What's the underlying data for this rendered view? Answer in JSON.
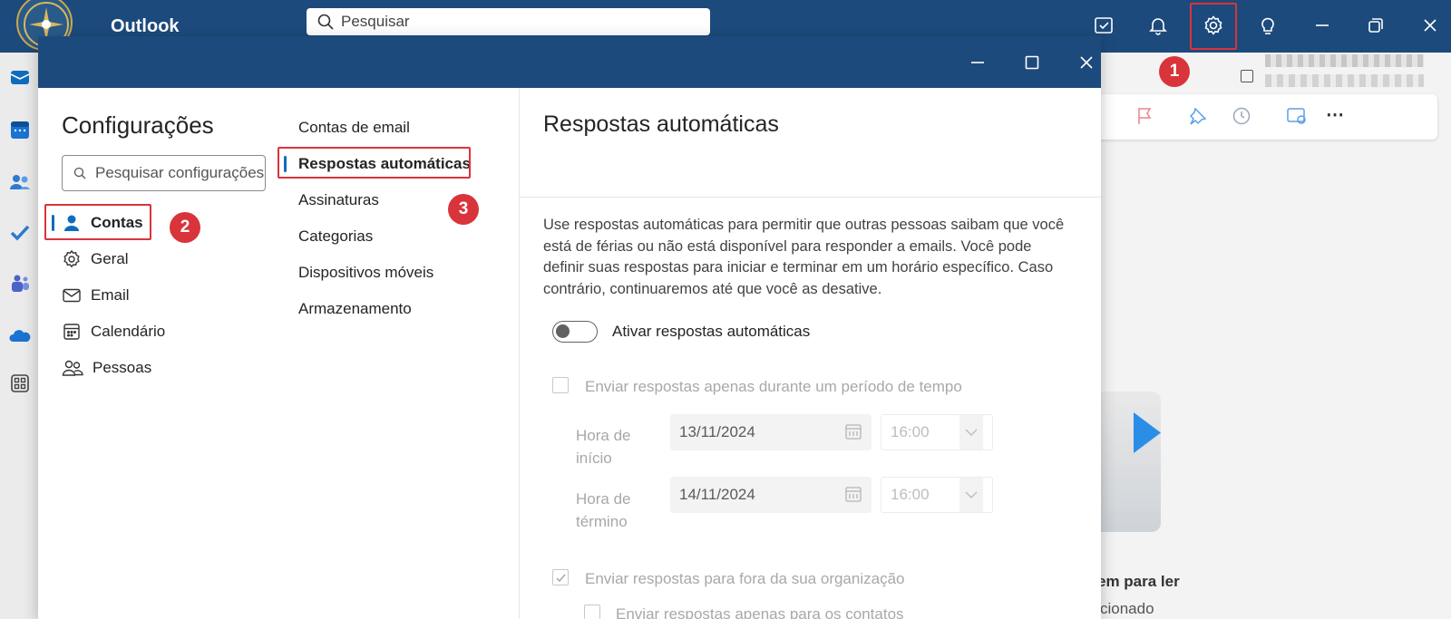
{
  "app": {
    "name": "Outlook"
  },
  "search": {
    "placeholder": "Pesquisar"
  },
  "badges": [
    "1",
    "2",
    "3"
  ],
  "settings": {
    "title": "Configurações",
    "search_placeholder": "Pesquisar configurações",
    "categories": [
      {
        "label": "Contas",
        "icon": "person-icon",
        "active": true
      },
      {
        "label": "Geral",
        "icon": "gear-icon"
      },
      {
        "label": "Email",
        "icon": "mail-icon"
      },
      {
        "label": "Calendário",
        "icon": "calendar-icon"
      },
      {
        "label": "Pessoas",
        "icon": "people-icon"
      }
    ],
    "subcategories": [
      {
        "label": "Contas de email"
      },
      {
        "label": "Respostas automáticas",
        "active": true
      },
      {
        "label": "Assinaturas"
      },
      {
        "label": "Categorias"
      },
      {
        "label": "Dispositivos móveis"
      },
      {
        "label": "Armazenamento"
      }
    ],
    "pane": {
      "title": "Respostas automáticas",
      "description": "Use respostas automáticas para permitir que outras pessoas saibam que você está de férias ou não está disponível para responder a emails. Você pode definir suas respostas para iniciar e terminar em um horário específico. Caso contrário, continuaremos até que você as desative.",
      "toggle_label": "Ativar respostas automáticas",
      "toggle_on": false,
      "period_checkbox_label": "Enviar respostas apenas durante um período de tempo",
      "start_label": "Hora de início",
      "start_date": "13/11/2024",
      "start_time": "16:00",
      "end_label": "Hora de término",
      "end_date": "14/11/2024",
      "end_time": "16:00",
      "outside_org_label": "Enviar respostas para fora da sua organização",
      "outside_org_checked": true,
      "contacts_only_label": "Enviar respostas apenas para os contatos"
    }
  },
  "background": {
    "reading_pane_text1": "em para ler",
    "reading_pane_text2": "cionado"
  },
  "colors": {
    "brand": "#1d4a7c",
    "highlight": "#d9343b",
    "accent": "#0f6cbd"
  }
}
